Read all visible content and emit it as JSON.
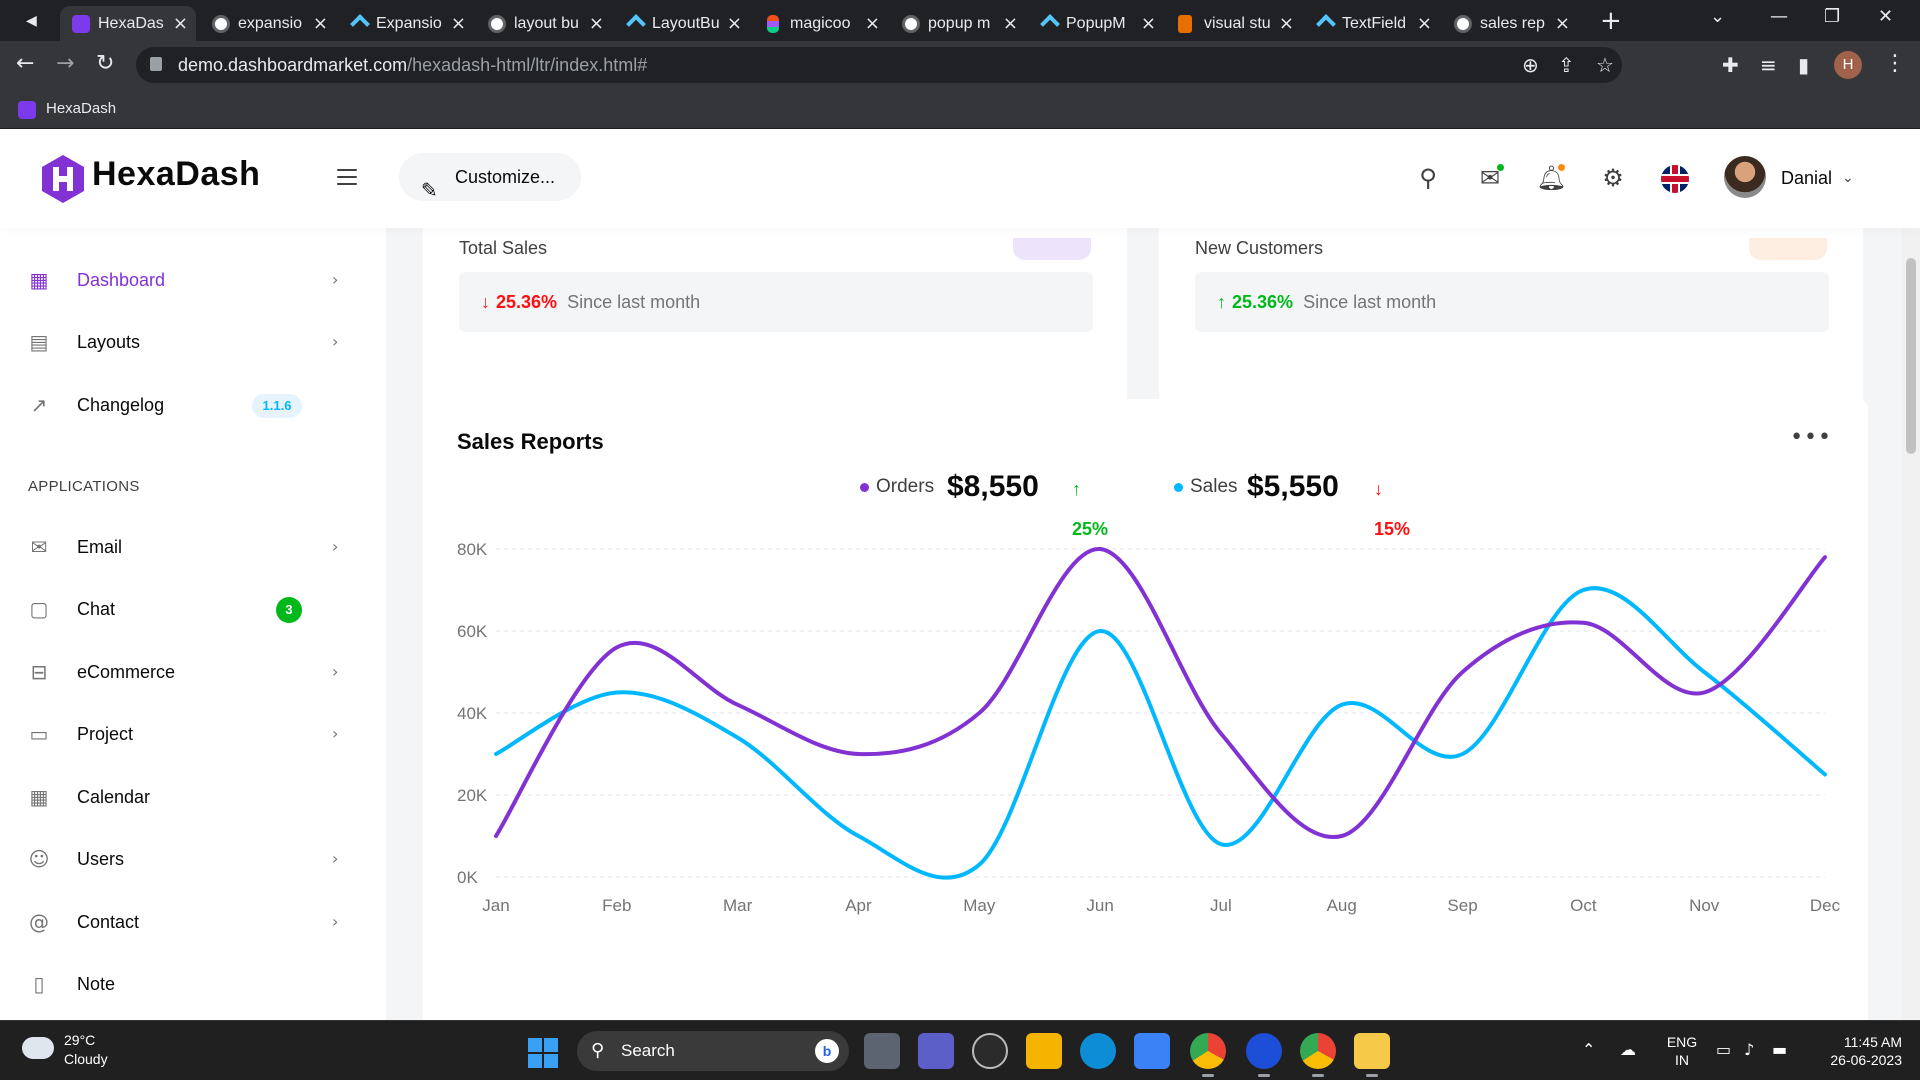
{
  "browser": {
    "tabs": [
      {
        "title": "HexaDas",
        "favicon": "hexadash-icon",
        "active": true
      },
      {
        "title": "expansio",
        "favicon": "google-icon"
      },
      {
        "title": "Expansio",
        "favicon": "flutter-icon"
      },
      {
        "title": "layout bu",
        "favicon": "google-icon"
      },
      {
        "title": "LayoutBu",
        "favicon": "flutter-icon"
      },
      {
        "title": "magicoo",
        "favicon": "figma-icon"
      },
      {
        "title": "popup m",
        "favicon": "google-icon"
      },
      {
        "title": "PopupM",
        "favicon": "flutter-icon"
      },
      {
        "title": "visual stu",
        "favicon": "java-icon"
      },
      {
        "title": "TextField",
        "favicon": "flutter-icon"
      },
      {
        "title": "sales rep",
        "favicon": "google-icon"
      }
    ],
    "url_host": "demo.dashboardmarket.com",
    "url_path": "/hexadash-html/ltr/index.html#",
    "bookmark": "HexaDash",
    "profile_initial": "H"
  },
  "header": {
    "brand": "HexaDash",
    "customize_label": "Customize...",
    "user_name": "Danial",
    "colors": {
      "brand": "#8231d3",
      "mail_dot": "#01b81a",
      "bell_dot": "#fa8b0c"
    }
  },
  "sidebar": {
    "items": [
      {
        "label": "Dashboard",
        "icon": "grid-plus-icon",
        "active": true,
        "chevron": true
      },
      {
        "label": "Layouts",
        "icon": "table-layout-icon",
        "chevron": true
      },
      {
        "label": "Changelog",
        "icon": "trend-up-icon",
        "badge": "1.1.6"
      }
    ],
    "section_label": "APPLICATIONS",
    "apps": [
      {
        "label": "Email",
        "icon": "envelope-icon",
        "chevron": true
      },
      {
        "label": "Chat",
        "icon": "chat-bubble-icon",
        "badge": "3"
      },
      {
        "label": "eCommerce",
        "icon": "shopping-bag-icon",
        "chevron": true
      },
      {
        "label": "Project",
        "icon": "folder-icon",
        "chevron": true
      },
      {
        "label": "Calendar",
        "icon": "calendar-icon"
      },
      {
        "label": "Users",
        "icon": "users-icon",
        "chevron": true
      },
      {
        "label": "Contact",
        "icon": "at-sign-icon",
        "chevron": true
      },
      {
        "label": "Note",
        "icon": "clipboard-icon"
      }
    ]
  },
  "stats": [
    {
      "title": "Total Sales",
      "change": "25.36%",
      "direction": "down",
      "since": "Since last month"
    },
    {
      "title": "New Customers",
      "change": "25.36%",
      "direction": "up",
      "since": "Since last month"
    }
  ],
  "report": {
    "title": "Sales Reports",
    "orders": {
      "label": "Orders",
      "amount": "$8,550",
      "change": "25%",
      "direction": "up"
    },
    "sales": {
      "label": "Sales",
      "amount": "$5,550",
      "change": "15%",
      "direction": "down"
    }
  },
  "chart_data": {
    "type": "line",
    "title": "Sales Reports",
    "categories": [
      "Jan",
      "Feb",
      "Mar",
      "Apr",
      "May",
      "Jun",
      "Jul",
      "Aug",
      "Sep",
      "Oct",
      "Nov",
      "Dec"
    ],
    "series": [
      {
        "name": "Orders",
        "color": "#8231d3",
        "values": [
          10000,
          56000,
          42000,
          30000,
          40000,
          80000,
          35000,
          10000,
          50000,
          62000,
          45000,
          78000
        ]
      },
      {
        "name": "Sales",
        "color": "#01b8ff",
        "values": [
          30000,
          45000,
          34000,
          10000,
          3000,
          60000,
          8000,
          42000,
          30000,
          70000,
          50000,
          25000
        ]
      }
    ],
    "y_ticks": [
      "0K",
      "20K",
      "40K",
      "60K",
      "80K"
    ],
    "ylim": [
      0,
      80000
    ],
    "grid": true,
    "legend": "top-center"
  },
  "taskbar": {
    "temperature": "29°C",
    "weather": "Cloudy",
    "search_label": "Search",
    "bing_label": "b",
    "lang_top": "ENG",
    "lang_bottom": "IN",
    "time": "11:45 AM",
    "date": "26-06-2023"
  }
}
